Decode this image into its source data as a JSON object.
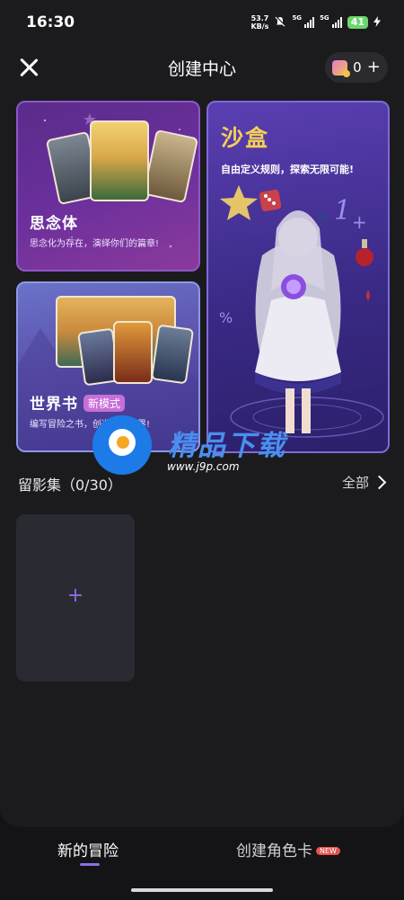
{
  "status_bar": {
    "time": "16:30",
    "speed_value": "53.7",
    "speed_unit": "KB/s",
    "network_1": "5G",
    "network_2": "5G",
    "battery": "41"
  },
  "header": {
    "title": "创建中心",
    "coin_count": "0",
    "coin_add": "+"
  },
  "cards": {
    "miss": {
      "title": "思念体",
      "subtitle": "思念化为存在，演绎你们的篇章!"
    },
    "sandbox": {
      "title": "沙盒",
      "subtitle": "自由定义规则，探索无限可能!"
    },
    "world": {
      "title": "世界书",
      "badge": "新模式",
      "subtitle": "编写冒险之书，创造你的世界!"
    }
  },
  "section": {
    "title": "留影集（0/30）",
    "view_all": "全部"
  },
  "gallery": {
    "add_label": "+"
  },
  "watermark": {
    "text": "精品下载",
    "url": "www.j9p.com"
  },
  "bottom_nav": {
    "items": [
      {
        "label": "新的冒险",
        "active": true
      },
      {
        "label": "创建角色卡",
        "badge": "NEW"
      }
    ]
  },
  "colors": {
    "accent": "#8b6ee6",
    "sandbox_title": "#f5cf56",
    "badge_pink": "#c86ed8",
    "new_badge": "#e5534f"
  }
}
